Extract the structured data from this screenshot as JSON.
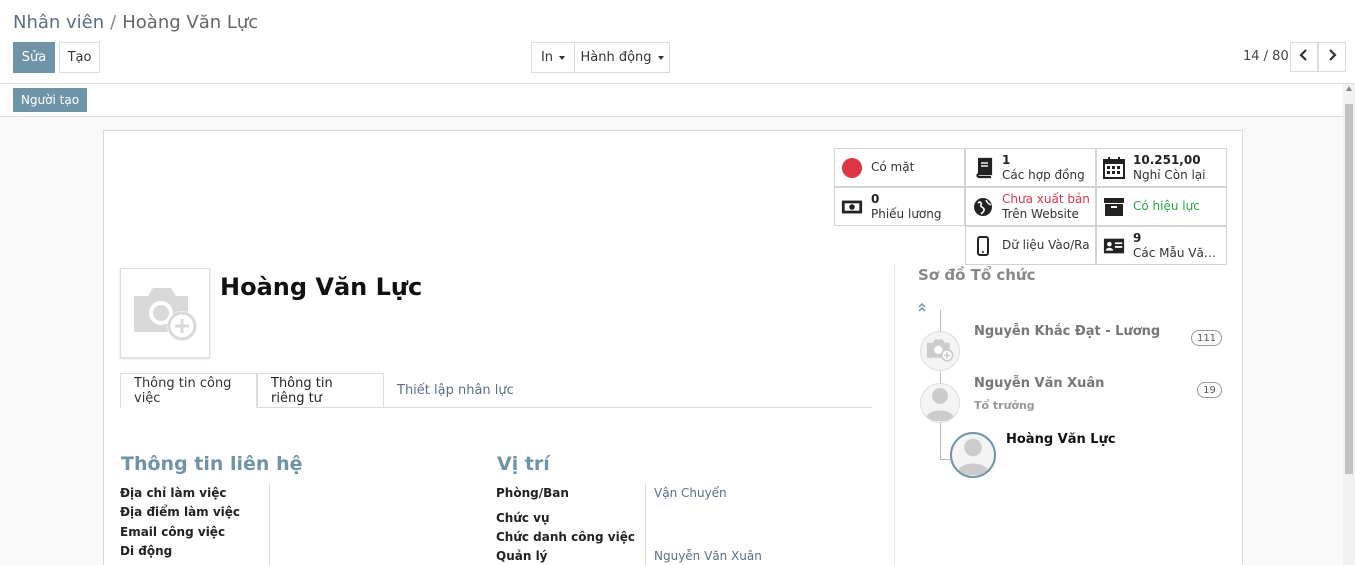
{
  "breadcrumb": {
    "parent": "Nhân viên",
    "separator": "/",
    "current": "Hoàng Văn Lực"
  },
  "toolbar": {
    "edit_label": "Sửa",
    "create_label": "Tạo",
    "print_label": "In",
    "action_label": "Hành động"
  },
  "pager": {
    "value": "14 / 80",
    "prev_icon": "chevron-left-icon",
    "next_icon": "chevron-right-icon"
  },
  "statusbar": {
    "creator_label": "Người tạo"
  },
  "smart_buttons": {
    "presence": {
      "label": "Có mặt",
      "color": "#dc3545"
    },
    "contracts": {
      "count": "1",
      "label": "Các hợp đồng"
    },
    "leave": {
      "count": "10.251,00",
      "label": "Nghỉ Còn lại"
    },
    "payslips": {
      "count": "0",
      "label": "Phiếu lương"
    },
    "website": {
      "status": "Chưa xuất bản",
      "label": "Trên Website",
      "status_color": "#dc3545"
    },
    "active": {
      "label": "Có hiệu lực",
      "color": "#28a745"
    },
    "attendance": {
      "label": "Dữ liệu Vào/Ra"
    },
    "templates": {
      "count": "9",
      "label": "Các Mẫu Văn ..."
    }
  },
  "employee": {
    "name": "Hoàng Văn Lực"
  },
  "tabs": [
    "Thông tin công việc",
    "Thông tin riêng tư",
    "Thiết lập nhân lực"
  ],
  "contact": {
    "title": "Thông tin liên hệ",
    "fields": [
      "Địa chỉ làm việc",
      "Địa điểm làm việc",
      "Email công việc",
      "Di động"
    ]
  },
  "position": {
    "title": "Vị trí",
    "fields": [
      {
        "label": "Phòng/Ban",
        "value": "Vận Chuyển"
      },
      {
        "label": "Chức vụ",
        "value": ""
      },
      {
        "label": "Chức danh công việc",
        "value": ""
      },
      {
        "label": "Quản lý",
        "value": "Nguyễn Văn Xuân"
      }
    ]
  },
  "org_chart": {
    "title": "Sơ đồ Tổ chức",
    "nodes": [
      {
        "name": "Nguyễn Khắc Đạt - Lương",
        "subtitle": "",
        "count": "111"
      },
      {
        "name": "Nguyễn Văn Xuân",
        "subtitle": "Tổ trưởng",
        "count": "19"
      },
      {
        "name": "Hoàng Văn Lực",
        "subtitle": "",
        "count": ""
      }
    ]
  },
  "colors": {
    "primary": "#6f93a7",
    "link": "#5c6e87"
  }
}
